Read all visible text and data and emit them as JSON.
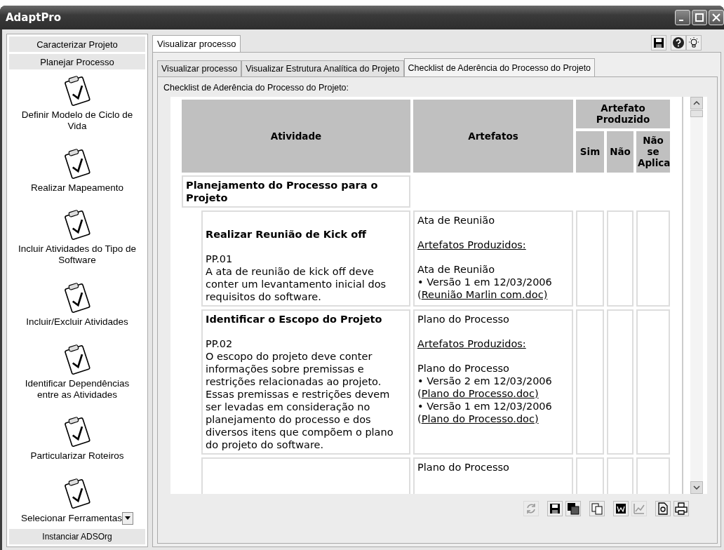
{
  "window": {
    "title": "AdaptPro"
  },
  "sidebar": {
    "sections": [
      {
        "label": "Caracterizar Projeto"
      },
      {
        "label": "Planejar Processo"
      }
    ],
    "items": [
      {
        "label": "Definir Modelo de Ciclo de Vida"
      },
      {
        "label": "Realizar Mapeamento"
      },
      {
        "label": "Incluir Atividades do Tipo de Software"
      },
      {
        "label": "Incluir/Excluir Atividades"
      },
      {
        "label": "Identificar Dependências entre as Atividades"
      },
      {
        "label": "Particularizar Roteiros"
      },
      {
        "label": "Selecionar Ferramentas"
      }
    ],
    "footer_section": {
      "label": "Instanciar ADSOrg"
    }
  },
  "outer_tabs": [
    {
      "label": "Visualizar processo",
      "selected": true
    }
  ],
  "inner_tabs": [
    {
      "label": "Visualizar processo",
      "selected": false
    },
    {
      "label": "Visualizar Estrutura Analítica do Projeto",
      "selected": false
    },
    {
      "label": "Checklist de Aderência do Processo do Projeto",
      "selected": true
    }
  ],
  "checklist": {
    "caption": "Checklist de Aderência do Processo do Projeto:",
    "columns": {
      "activity": "Atividade",
      "artifacts": "Artefatos",
      "produced": "Artefato Produzido",
      "options": [
        "Sim",
        "Não",
        "Não se Aplica"
      ]
    },
    "group": "Planejamento do Processo para o Projeto",
    "rows": [
      {
        "title": "Realizar Reunião de Kick off",
        "code": "PP.01",
        "description": "A ata de reunião de kick off deve conter um levantamento inicial dos requisitos do software.",
        "artifact": "Ata de Reunião",
        "produced_label": "Artefatos Produzidos:",
        "produced_name": "Ata de Reunião",
        "versions": [
          {
            "text": "•  Versão 1 em 12/03/2006 (",
            "link": "Reunião Marlin com.doc)"
          }
        ]
      },
      {
        "title": "Identificar o Escopo do Projeto",
        "code": "PP.02",
        "description": "O escopo do projeto deve conter informações sobre premissas e restrições relacionadas ao projeto. Essas premissas e restrições devem ser levadas em consideração no planejamento do processo e dos diversos itens que compõem o plano do projeto do software.",
        "artifact": "Plano do Processo",
        "produced_label": "Artefatos Produzidos:",
        "produced_name": "Plano do Processo",
        "versions": [
          {
            "text": "•  Versão 2 em 12/03/2006 (",
            "link": "Plano do Processo.doc)"
          },
          {
            "text": "•  Versão 1 em 12/03/2006 (",
            "link": "Plano do Processo.doc)"
          }
        ]
      },
      {
        "artifact": "Plano do Processo"
      }
    ]
  },
  "bottom_toolbar": [
    {
      "disabled": true
    },
    {
      "disabled": false
    },
    {
      "disabled": false
    },
    {
      "disabled": false
    },
    {
      "disabled": false
    },
    {
      "disabled": true
    },
    {
      "disabled": false
    },
    {
      "disabled": false
    }
  ]
}
